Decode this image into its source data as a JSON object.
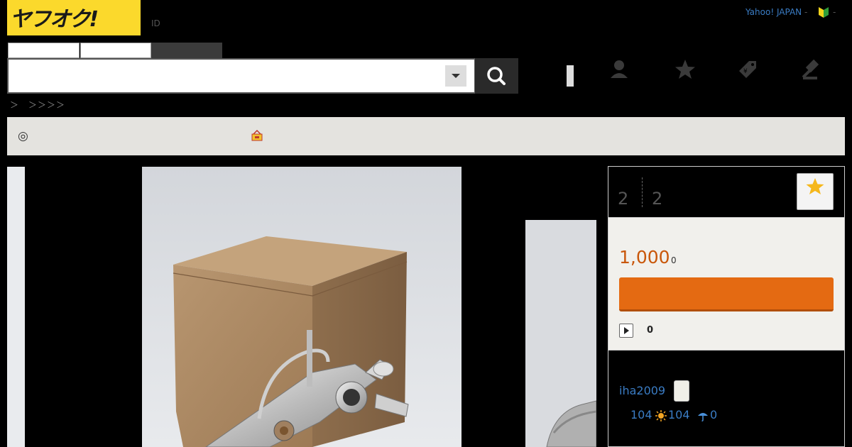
{
  "header": {
    "logo_text": "ヤフオク!",
    "id_label": "ID",
    "yahoo_japan_link": "Yahoo! JAPAN",
    "dash": "-",
    "dash2": "-"
  },
  "breadcrumb": "＞　＞＞＞＞",
  "banner": {
    "mark": "◎"
  },
  "item_panel": {
    "watch_count": "2",
    "access_count": "2",
    "price": "1,000",
    "tax_note": "0",
    "bid_count": "0"
  },
  "seller": {
    "id": "iha2009",
    "rating_total": "104",
    "rating_good": "104",
    "rating_bad": "0"
  },
  "colors": {
    "logo_bg": "#fbd92c",
    "price": "#c9570a",
    "bid_button": "#e46a12",
    "link": "#3a7cc4",
    "banner_bg": "#e4e3df",
    "panel_bg": "#f1f0ec"
  }
}
